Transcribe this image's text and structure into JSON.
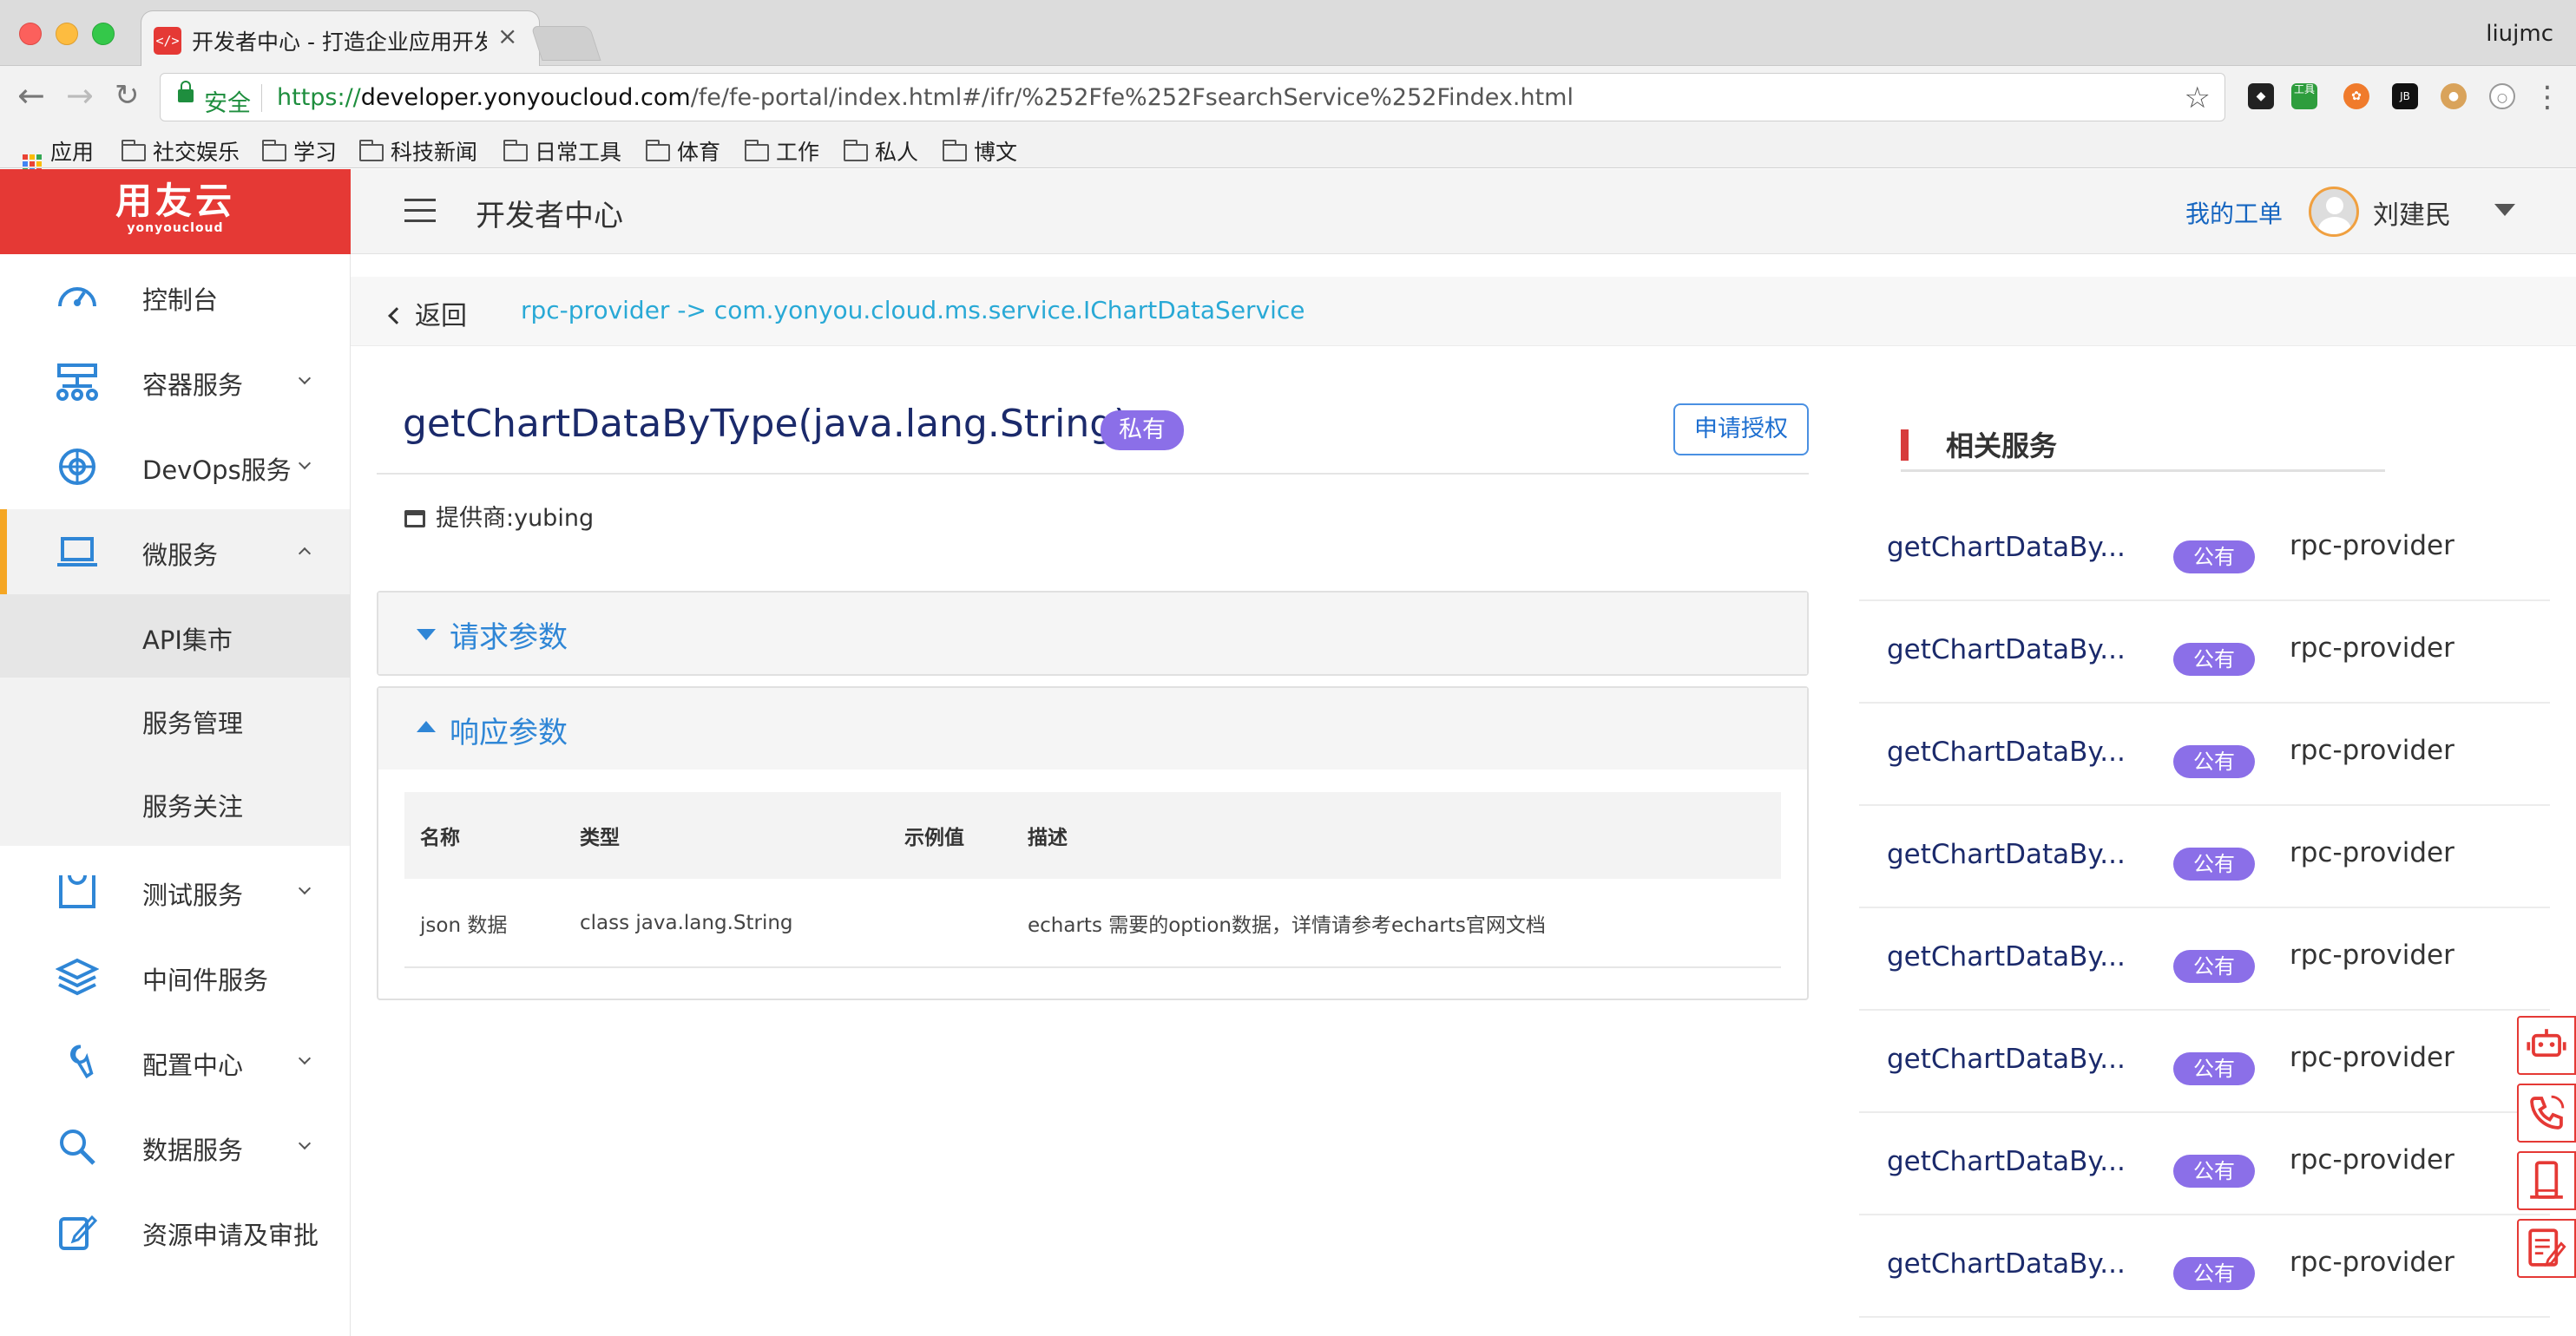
{
  "browser": {
    "tab_title": "开发者中心 - 打造企业应用开发",
    "tab_close": "×",
    "profile": "liujmc",
    "url": {
      "secure_label": "安全",
      "scheme": "https://",
      "host": "developer.yonyoucloud.com",
      "path": "/fe/fe-portal/index.html#/ifr/%252Ffe%252FsearchService%252Findex.html"
    },
    "bookmarks": [
      "应用",
      "社交娱乐",
      "学习",
      "科技新闻",
      "日常工具",
      "体育",
      "工作",
      "私人",
      "博文"
    ],
    "ext_tools_label": "工具"
  },
  "header": {
    "logo_main": "用友云",
    "logo_sub": "yonyoucloud",
    "page_title": "开发者中心",
    "ticket_link": "我的工单",
    "user_name": "刘建民"
  },
  "sidebar": {
    "items": [
      {
        "label": "控制台",
        "icon": "dashboard-icon"
      },
      {
        "label": "容器服务",
        "icon": "container-icon"
      },
      {
        "label": "DevOps服务",
        "icon": "devops-icon"
      },
      {
        "label": "微服务",
        "icon": "laptop-icon"
      },
      {
        "label": "测试服务",
        "icon": "test-icon"
      },
      {
        "label": "中间件服务",
        "icon": "layers-icon"
      },
      {
        "label": "配置中心",
        "icon": "wrench-icon"
      },
      {
        "label": "数据服务",
        "icon": "search-icon"
      },
      {
        "label": "资源申请及审批",
        "icon": "edit-icon"
      }
    ],
    "sub_items": [
      "API集市",
      "服务管理",
      "服务关注"
    ]
  },
  "breadcrumb": {
    "back_label": "返回",
    "path": "rpc-provider -> com.yonyou.cloud.ms.service.IChartDataService"
  },
  "detail": {
    "method_title": "getChartDataByType(java.lang.String)",
    "visibility_badge": "私有",
    "apply_button": "申请授权",
    "provider": "提供商:yubing",
    "request_panel_title": "请求参数",
    "response_panel_title": "响应参数",
    "response_table": {
      "headers": [
        "名称",
        "类型",
        "示例值",
        "描述"
      ],
      "rows": [
        [
          "json 数据",
          "class java.lang.String",
          "",
          "echarts 需要的option数据，详情请参考echarts官网文档"
        ]
      ]
    }
  },
  "related": {
    "title": "相关服务",
    "items": [
      {
        "name": "getChartDataBy...",
        "badge": "公有",
        "provider": "rpc-provider"
      },
      {
        "name": "getChartDataBy...",
        "badge": "公有",
        "provider": "rpc-provider"
      },
      {
        "name": "getChartDataBy...",
        "badge": "公有",
        "provider": "rpc-provider"
      },
      {
        "name": "getChartDataBy...",
        "badge": "公有",
        "provider": "rpc-provider"
      },
      {
        "name": "getChartDataBy...",
        "badge": "公有",
        "provider": "rpc-provider"
      },
      {
        "name": "getChartDataBy...",
        "badge": "公有",
        "provider": "rpc-provider"
      },
      {
        "name": "getChartDataBy...",
        "badge": "公有",
        "provider": "rpc-provider"
      },
      {
        "name": "getChartDataBy...",
        "badge": "公有",
        "provider": "rpc-provider"
      }
    ]
  },
  "floating_buttons": [
    "robot-icon",
    "phone-icon",
    "mobile-icon",
    "notes-icon"
  ],
  "colors": {
    "brand_red": "#e53935",
    "badge_purple": "#8b6fe8",
    "link_blue": "#2f86d6",
    "active_orange": "#f5a623"
  }
}
